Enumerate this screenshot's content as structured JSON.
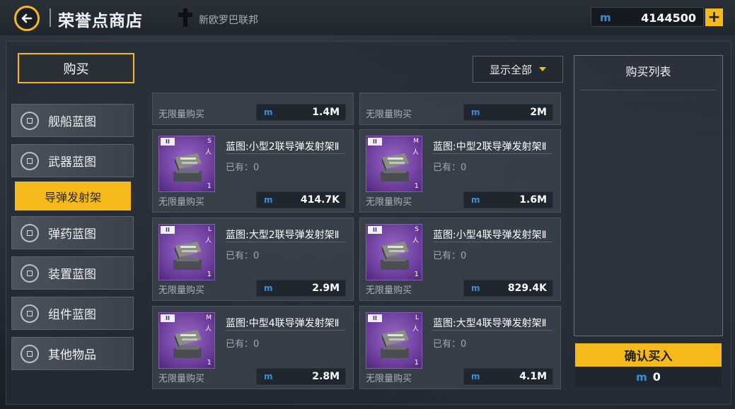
{
  "header": {
    "title": "荣誉点商店",
    "faction_name": "新欧罗巴联邦",
    "currency_icon": "m",
    "currency_value": "4144500",
    "plus_label": "+"
  },
  "tabs": {
    "buy_label": "购买"
  },
  "filter": {
    "selected": "显示全部"
  },
  "sidebar": {
    "items": [
      {
        "label": "舰船蓝图",
        "icon": "blueprint-icon"
      },
      {
        "label": "武器蓝图",
        "icon": "weapon-icon"
      },
      {
        "label": "导弹发射架",
        "icon": "",
        "active": true
      },
      {
        "label": "弹药蓝图",
        "icon": "ammo-icon"
      },
      {
        "label": "装置蓝图",
        "icon": "device-icon"
      },
      {
        "label": "组件蓝图",
        "icon": "component-icon"
      },
      {
        "label": "其他物品",
        "icon": "cube-icon"
      }
    ]
  },
  "partial_items": [
    {
      "unlimited": "无限量购买",
      "price": "1.4M"
    },
    {
      "unlimited": "无限量购买",
      "price": "2M"
    }
  ],
  "items": [
    {
      "name": "蓝图:小型2联导弹发射架Ⅱ",
      "owned": "已有：0",
      "unlimited": "无限量购买",
      "price": "414.7K",
      "tier": "II",
      "size": "S",
      "count": "1"
    },
    {
      "name": "蓝图:中型2联导弹发射架Ⅱ",
      "owned": "已有：0",
      "unlimited": "无限量购买",
      "price": "1.6M",
      "tier": "II",
      "size": "M",
      "count": "1"
    },
    {
      "name": "蓝图:大型2联导弹发射架Ⅱ",
      "owned": "已有：0",
      "unlimited": "无限量购买",
      "price": "2.9M",
      "tier": "II",
      "size": "L",
      "count": "1"
    },
    {
      "name": "蓝图:小型4联导弹发射架Ⅱ",
      "owned": "已有：0",
      "unlimited": "无限量购买",
      "price": "829.4K",
      "tier": "II",
      "size": "S",
      "count": "1"
    },
    {
      "name": "蓝图:中型4联导弹发射架Ⅱ",
      "owned": "已有：0",
      "unlimited": "无限量购买",
      "price": "2.8M",
      "tier": "II",
      "size": "M",
      "count": "1"
    },
    {
      "name": "蓝图:大型4联导弹发射架Ⅱ",
      "owned": "已有：0",
      "unlimited": "无限量购买",
      "price": "4.1M",
      "tier": "II",
      "size": "L",
      "count": "1"
    }
  ],
  "purchase_list": {
    "title": "购买列表",
    "confirm_label": "确认买入",
    "total": "0"
  },
  "colors": {
    "accent": "#f5b91a",
    "currency": "#3a8fd8",
    "thumb_purple": "#7a4aaa"
  }
}
